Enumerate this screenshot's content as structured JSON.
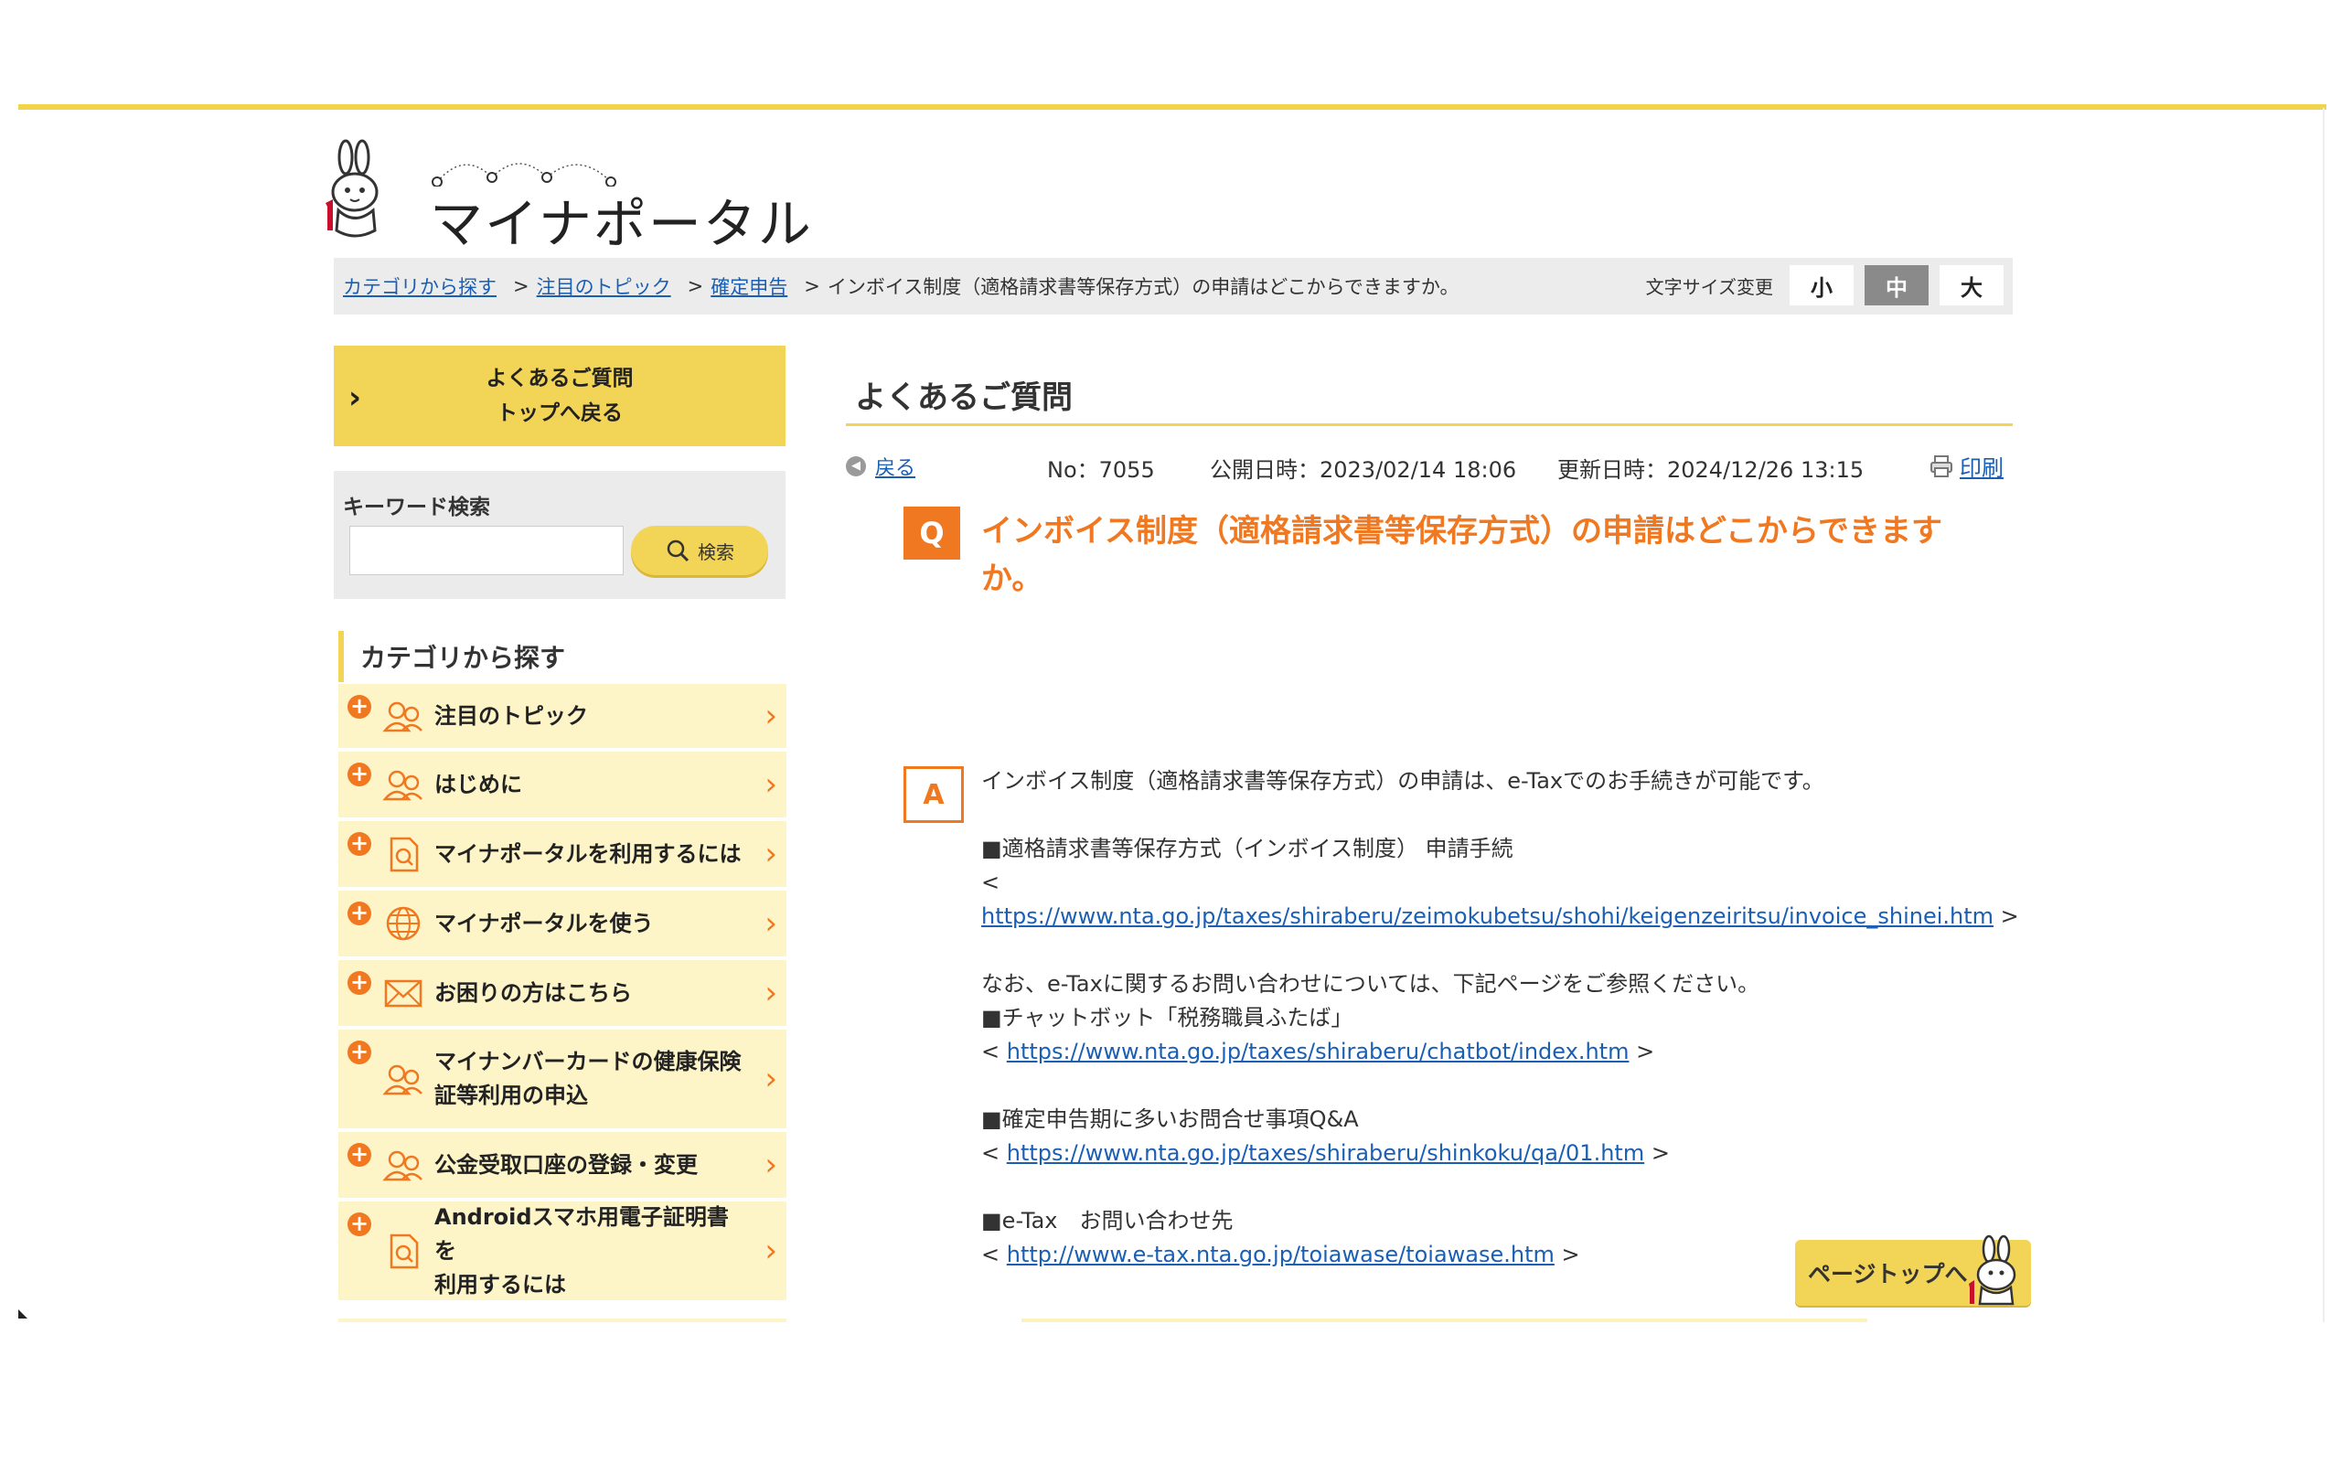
{
  "logo": {
    "text": "マイナポータル"
  },
  "breadcrumb": {
    "items": [
      "カテゴリから探す",
      "注目のトピック",
      "確定申告"
    ],
    "separator": ">",
    "current": "インボイス制度（適格請求書等保存方式）の申請はどこからできますか。"
  },
  "font_size": {
    "label": "文字サイズ変更",
    "options": [
      "小",
      "中",
      "大"
    ],
    "selected": "中"
  },
  "sidebar": {
    "faq_top": {
      "line1": "よくあるご質問",
      "line2": "トップへ戻る"
    },
    "search": {
      "title": "キーワード検索",
      "input_value": "",
      "button_label": "検索"
    },
    "category_heading": "カテゴリから探す",
    "categories": [
      {
        "line1": "注目のトピック",
        "line2": "",
        "icon": "people-icon"
      },
      {
        "line1": "はじめに",
        "line2": "",
        "icon": "people-icon"
      },
      {
        "line1": "マイナポータルを利用するには",
        "line2": "",
        "icon": "document-icon"
      },
      {
        "line1": "マイナポータルを使う",
        "line2": "",
        "icon": "globe-icon"
      },
      {
        "line1": "お困りの方はこちら",
        "line2": "",
        "icon": "mail-icon"
      },
      {
        "line1": "マイナンバーカードの健康保険",
        "line2": "証等利用の申込",
        "icon": "people-icon"
      },
      {
        "line1": "公金受取口座の登録・変更",
        "line2": "",
        "icon": "people-icon"
      },
      {
        "line1": "Androidスマホ用電子証明書を",
        "line2": "利用するには",
        "icon": "document-icon"
      }
    ]
  },
  "main": {
    "title": "よくあるご質問",
    "back_label": "戻る",
    "no": "No：7055",
    "published": "公開日時：2023/02/14 18:06",
    "updated": "更新日時：2024/12/26 13:15",
    "print_label": "印刷",
    "q_badge": "Q",
    "question": "インボイス制度（適格請求書等保存方式）の申請はどこからできますか。",
    "a_badge": "A",
    "answer": {
      "intro": "インボイス制度（適格請求書等保存方式）の申請は、e-Taxでのお手続きが可能です。",
      "section1_title": "■適格請求書等保存方式（インボイス制度） 申請手続",
      "open_bracket": "<",
      "link1": "https://www.nta.go.jp/taxes/shiraberu/zeimokubetsu/shohi/keigenzeiritsu/invoice_shinei.htm",
      "close_bracket": ">",
      "note": "なお、e-Taxに関するお問い合わせについては、下記ページをご参照ください。",
      "section2_title": "■チャットボット「税務職員ふたば」",
      "link2": "https://www.nta.go.jp/taxes/shiraberu/chatbot/index.htm",
      "section3_title": "■確定申告期に多いお問合せ事項Q&A",
      "link3": "https://www.nta.go.jp/taxes/shiraberu/shinkoku/qa/01.htm",
      "section4_title": "■e-Tax　お問い合わせ先",
      "link4": "http://www.e-tax.nta.go.jp/toiawase/toiawase.htm"
    },
    "page_top_label": "ページトップへ"
  },
  "colors": {
    "accent_yellow": "#f2d457",
    "accent_orange": "#f07820",
    "link_blue": "#1a5fb4",
    "category_bg": "#fdf4c8"
  }
}
